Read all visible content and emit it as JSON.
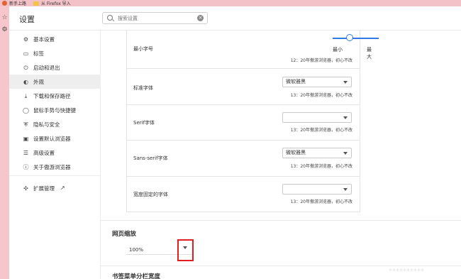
{
  "bookmarks_bar": {
    "items": [
      {
        "label": "新手上路",
        "icon": "firefox-fav-icon"
      },
      {
        "label": "从 Firefox 导入",
        "icon": "folder-icon"
      }
    ]
  },
  "left_strip": {
    "icons": [
      "star-icon",
      "gear-icon"
    ]
  },
  "header": {
    "title": "设置",
    "search": {
      "placeholder": "搜索设置"
    }
  },
  "sidebar": {
    "items": [
      {
        "label": "基本设置",
        "icon": "basic-settings-icon",
        "active": false
      },
      {
        "label": "标签",
        "icon": "tab-icon",
        "active": false
      },
      {
        "label": "启动和退出",
        "icon": "power-icon",
        "active": false
      },
      {
        "label": "外观",
        "icon": "palette-icon",
        "active": true
      },
      {
        "label": "下载和保存路径",
        "icon": "download-icon",
        "active": false
      },
      {
        "label": "鼠标手势与快捷键",
        "icon": "mouse-icon",
        "active": false
      },
      {
        "label": "隐私与安全",
        "icon": "shield-icon",
        "active": false
      },
      {
        "label": "设置默认浏览器",
        "icon": "browser-icon",
        "active": false
      },
      {
        "label": "高级设置",
        "icon": "sliders-icon",
        "active": false
      },
      {
        "label": "关于傲游浏览器",
        "icon": "info-icon",
        "active": false
      }
    ],
    "extensions": {
      "label": "扩展管理",
      "icon": "puzzle-icon",
      "external_icon": "external-link-icon"
    }
  },
  "font_settings": {
    "min_font": {
      "label": "最小字号",
      "slider": {
        "min_label": "最小",
        "max_label": "最大",
        "value_fraction": 0.3
      },
      "note": "12：20年傲游浏览器，初心不改"
    },
    "rows": [
      {
        "label": "标准字体",
        "value": "微软雅黑",
        "note": "13：20年傲游浏览器，初心不改"
      },
      {
        "label": "Serif字体",
        "value": "",
        "note": "13：20年傲游浏览器，初心不改"
      },
      {
        "label": "Sans-serif字体",
        "value": "微软雅黑",
        "note": "13：20年傲游浏览器，初心不改"
      },
      {
        "label": "宽度固定的字体",
        "value": "",
        "note": "13：20年傲游浏览器，初心不改"
      }
    ]
  },
  "zoom": {
    "title": "网页缩放",
    "value": "100%"
  },
  "bookmark_menu": {
    "title": "书签菜单分栏宽度"
  },
  "watermark": "**********"
}
